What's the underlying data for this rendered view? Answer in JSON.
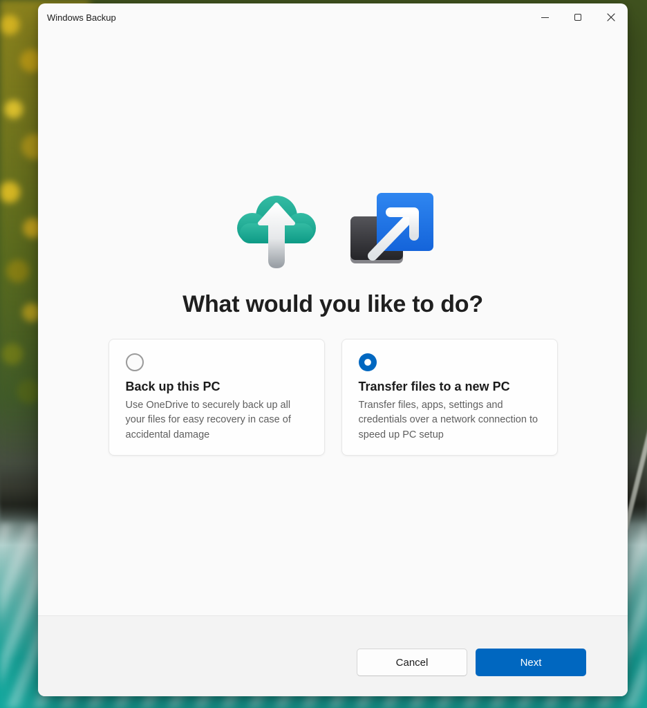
{
  "window": {
    "title": "Windows Backup"
  },
  "main": {
    "heading": "What would you like to do?",
    "icons": [
      "cloud-backup-icon",
      "transfer-files-icon"
    ],
    "options": [
      {
        "title": "Back up this PC",
        "description": "Use OneDrive to securely back up all your files for easy recovery in case of accidental damage",
        "selected": false
      },
      {
        "title": "Transfer files to a new PC",
        "description": "Transfer files, apps, settings and credentials over a network connection to speed up PC setup",
        "selected": true
      }
    ]
  },
  "footer": {
    "cancel_label": "Cancel",
    "next_label": "Next"
  },
  "colors": {
    "accent_blue": "#0067C0",
    "cloud_teal": "#16A08B",
    "transfer_blue": "#1E6FE3"
  }
}
